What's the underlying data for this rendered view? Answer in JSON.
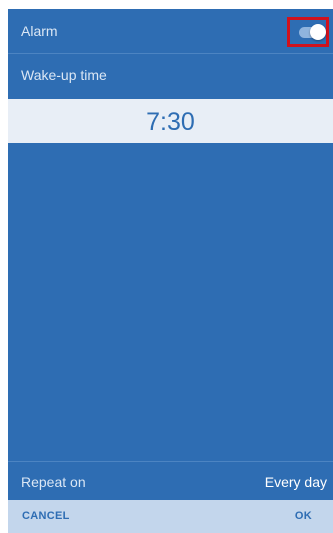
{
  "alarm": {
    "label": "Alarm",
    "enabled": true
  },
  "wake_up": {
    "label": "Wake-up time",
    "time": "7:30"
  },
  "repeat": {
    "label": "Repeat on",
    "value": "Every day"
  },
  "buttons": {
    "cancel": "CANCEL",
    "ok": "OK"
  },
  "colors": {
    "background": "#2e6db3",
    "time_band": "#e8eef6",
    "button_bar": "#c3d6ec",
    "highlight": "#d0121d"
  }
}
